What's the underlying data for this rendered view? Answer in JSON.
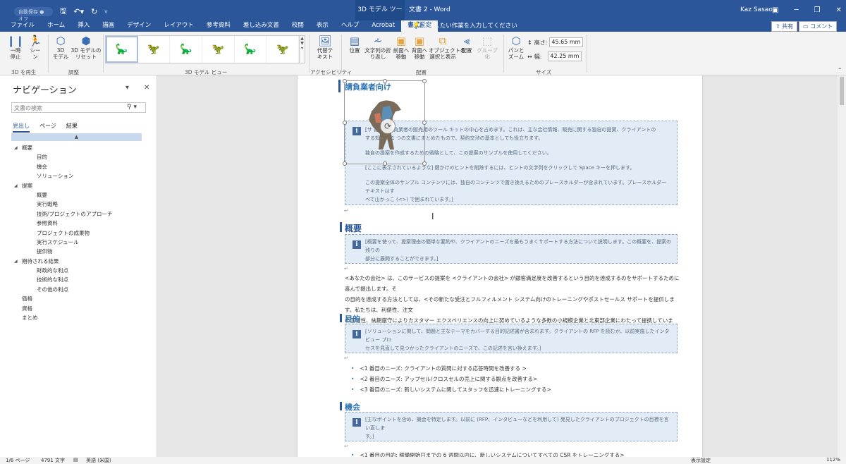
{
  "titlebar": {
    "autosave": "自動保存 ● オフ",
    "context_tab": "3D モデル ツール",
    "doc_title": "文書 2  -  Word",
    "user": "Kaz Sasao"
  },
  "tabs": [
    "ファイル",
    "ホーム",
    "挿入",
    "描画",
    "デザイン",
    "レイアウト",
    "参考資料",
    "差し込み文書",
    "校閲",
    "表示",
    "ヘルプ",
    "Acrobat",
    "書式設定"
  ],
  "tellme": "実行したい作業を入力してください",
  "share": "共有",
  "comment": "コメント",
  "ribbon": {
    "pause": "一時\n停止",
    "scene": "シー\nン",
    "group_play": "3D を再生",
    "model3d": "3D\nモデル",
    "reset": "3D モデルの\nリセット",
    "group_adjust": "調整",
    "group_view": "3D モデル ビュー",
    "alt_text": "代替テ\nキスト",
    "group_access": "アクセシビリティ",
    "position": "位置",
    "wrap": "文字列の折\nり返し",
    "forward": "前面へ\n移動",
    "backward": "背面へ\n移動",
    "select_pane": "オブジェクトの\n選択と表示",
    "align": "配置",
    "group_btn": "グループ化",
    "group_arrange": "配置",
    "pan_zoom": "パンと\nズーム",
    "height_label": "高さ:",
    "height_val": "45.65 mm",
    "width_label": "幅:",
    "width_val": "42.25 mm",
    "group_size": "サイズ"
  },
  "nav": {
    "title": "ナビゲーション",
    "search_placeholder": "文書の検索",
    "tabs": [
      "見出し",
      "ページ",
      "結果"
    ],
    "tree": [
      {
        "level": 1,
        "label": "概要",
        "caret": "◢"
      },
      {
        "level": 2,
        "label": "目的"
      },
      {
        "level": 2,
        "label": "機会"
      },
      {
        "level": 2,
        "label": "ソリューション"
      },
      {
        "level": 1,
        "label": "提案",
        "caret": "◢"
      },
      {
        "level": 2,
        "label": "概要"
      },
      {
        "level": 2,
        "label": "実行戦略"
      },
      {
        "level": 2,
        "label": "技術/プロジェクトのアプローチ"
      },
      {
        "level": 2,
        "label": "参照資料"
      },
      {
        "level": 2,
        "label": "プロジェクトの成果物"
      },
      {
        "level": 2,
        "label": "実行スケジュール"
      },
      {
        "level": 2,
        "label": "提供物"
      },
      {
        "level": 1,
        "label": "期待される結果",
        "caret": "◢"
      },
      {
        "level": 2,
        "label": "財政的な利点"
      },
      {
        "level": 2,
        "label": "技術的な利点"
      },
      {
        "level": 2,
        "label": "その他の利点"
      },
      {
        "level": 0,
        "label": "価格"
      },
      {
        "level": 0,
        "label": "資格"
      },
      {
        "level": 0,
        "label": "まとめ"
      }
    ]
  },
  "doc": {
    "subtitle": "請負業者向け",
    "tip1_lines": [
      "[サ             書は、請負業者の販売用のツール キットの中心を占めます。これは、主な会社情報、販売に関する独自の提案、クライアントの",
      "            する知識を 1 つの文書にまとめたもので、契約交渉の基本としても役立ちます。",
      "独自の提案を作成するための戦略として、この提案のサンプルを使用してください。",
      "[ここに表示されているような] 鍵かけのヒントを削除するには、ヒントの文字列をクリックして Space キーを押します。",
      "この提案全体のサンプル コンテンツには、独自のコンテンツで置き換えるためのプレースホルダーが含まれています。プレースホルダー テキストはす",
      "べて山かっこ (<>) で囲まれています。]"
    ],
    "h_overview": "概要",
    "tip2_lines": [
      "[概要を使って、提案理由の簡単な要約や、クライアントのニーズを最もうまくサポートする方法について説明します。この概要を、提案の残りの",
      "部分に展開することができます。]"
    ],
    "overview_lines": [
      "<あなたの会社> は、このサービスの提案を <クライアントの会社> が顧客満足度を改善するという目的を達成するのをサポートするために喜んで提出します。そ",
      "の目的を達成する方法としては、<その新たな受注とフルフィルメント システム向けのトレーニングやポストセールス サポートを提供します。私たちは、利便性、注文",
      "の正確性、納期厳守によりカスタマー エクスペリエンスの向上に努めているような多数の小規模企業と北東部企業にわたって提携しています。>"
    ],
    "h_purpose": "目的",
    "tip3_lines": [
      "[ソリューションに関して、問題と主なテーマをカバーする目的記述書が含まれます。クライアントの RFP を読むか、以前実施したインタビュー プロ",
      "セスを見直して見つかったクライアントのニーズで、この記述を言い換えます。]"
    ],
    "bullets": [
      "<1 番目のニーズ: クライアントの質問に対する応答時間を改善する >",
      "<2 番目のニーズ: アップセル/クロスセルの売上に関する観点を改善する>",
      "<3 番目のニーズ: 新しいシステムに関してスタッフを迅速にトレーニングする>"
    ],
    "h_opportunity": "機会",
    "tip4_lines": [
      "[主なポイントを含め、機会を特定します。以前に (RFP、インタビューなどを利用して) 発見したクライアントのプロジェクトの目標を言い直しま",
      "す。]"
    ],
    "bullet_last": "<1 番目の目的: 稼働開始日までの 6 週間以内に、新しいシステムについてすべての CSR をトレーニングする>"
  },
  "status": {
    "page": "1/6 ページ",
    "words": "4791 文字",
    "lang": "英語 (米国)",
    "display": "表示設定",
    "zoom": "112%"
  },
  "colors": {
    "brand": "#2b579a",
    "heading": "#2e75b6",
    "tip_bg": "#e2ecf7"
  }
}
